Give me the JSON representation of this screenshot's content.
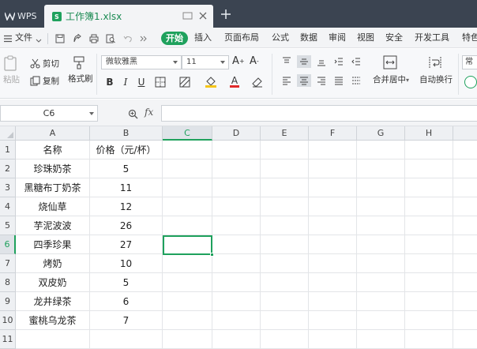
{
  "app": {
    "name": "WPS",
    "tab_title": "工作簿1.xlsx",
    "accent": "#1fa15d"
  },
  "menu": {
    "file_label": "文件",
    "items": [
      "开始",
      "插入",
      "页面布局",
      "公式",
      "数据",
      "审阅",
      "视图",
      "安全",
      "开发工具",
      "特色"
    ],
    "active": "开始"
  },
  "ribbon": {
    "paste": "粘贴",
    "cut": "剪切",
    "copy": "复制",
    "format_painter": "格式刷",
    "font_name": "微软雅黑",
    "font_size": "11",
    "merge_center": "合并居中",
    "wrap_text": "自动换行",
    "number_format": "常"
  },
  "formula_bar": {
    "cell_ref": "C6",
    "fx": "fx",
    "formula": ""
  },
  "grid": {
    "columns": [
      "A",
      "B",
      "C",
      "D",
      "E",
      "F",
      "G",
      "H"
    ],
    "rows": [
      "1",
      "2",
      "3",
      "4",
      "5",
      "6",
      "7",
      "8",
      "9",
      "10",
      "11"
    ],
    "selected_col": "C",
    "selected_row": "6",
    "cells": [
      [
        "名称",
        "价格（元/杯）"
      ],
      [
        "珍珠奶茶",
        "5"
      ],
      [
        "黑糖布丁奶茶",
        "11"
      ],
      [
        "烧仙草",
        "12"
      ],
      [
        "芋泥波波",
        "26"
      ],
      [
        "四季珍果",
        "27"
      ],
      [
        "烤奶",
        "10"
      ],
      [
        "双皮奶",
        "5"
      ],
      [
        "龙井绿茶",
        "6"
      ],
      [
        "蜜桃乌龙茶",
        "7"
      ],
      [
        "",
        ""
      ]
    ]
  }
}
